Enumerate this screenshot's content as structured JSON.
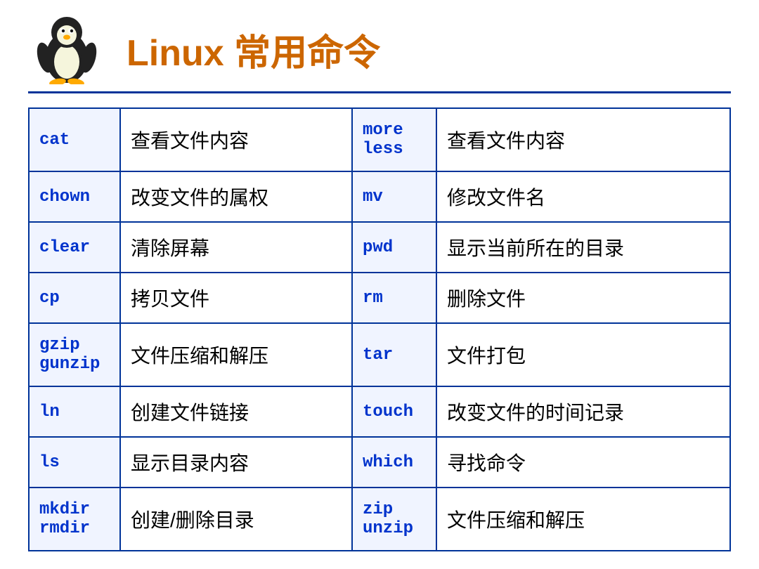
{
  "header": {
    "title": "Linux 常用命令"
  },
  "table": {
    "rows": [
      {
        "cmd1": "cat",
        "desc1": "查看文件内容",
        "cmd2": "more\nless",
        "desc2": "查看文件内容"
      },
      {
        "cmd1": "chown",
        "desc1": "改变文件的属权",
        "cmd2": "mv",
        "desc2": "修改文件名"
      },
      {
        "cmd1": "clear",
        "desc1": "清除屏幕",
        "cmd2": "pwd",
        "desc2": "显示当前所在的目录"
      },
      {
        "cmd1": "cp",
        "desc1": "拷贝文件",
        "cmd2": "rm",
        "desc2": "删除文件"
      },
      {
        "cmd1": "gzip\ngunzip",
        "desc1": "文件压缩和解压",
        "cmd2": "tar",
        "desc2": "文件打包"
      },
      {
        "cmd1": "ln",
        "desc1": "创建文件链接",
        "cmd2": "touch",
        "desc2": "改变文件的时间记录"
      },
      {
        "cmd1": "ls",
        "desc1": "显示目录内容",
        "cmd2": "which",
        "desc2": "寻找命令"
      },
      {
        "cmd1": "mkdir\nrmdir",
        "desc1": "创建/删除目录",
        "cmd2": "zip\nunzip",
        "desc2": "文件压缩和解压"
      }
    ]
  }
}
